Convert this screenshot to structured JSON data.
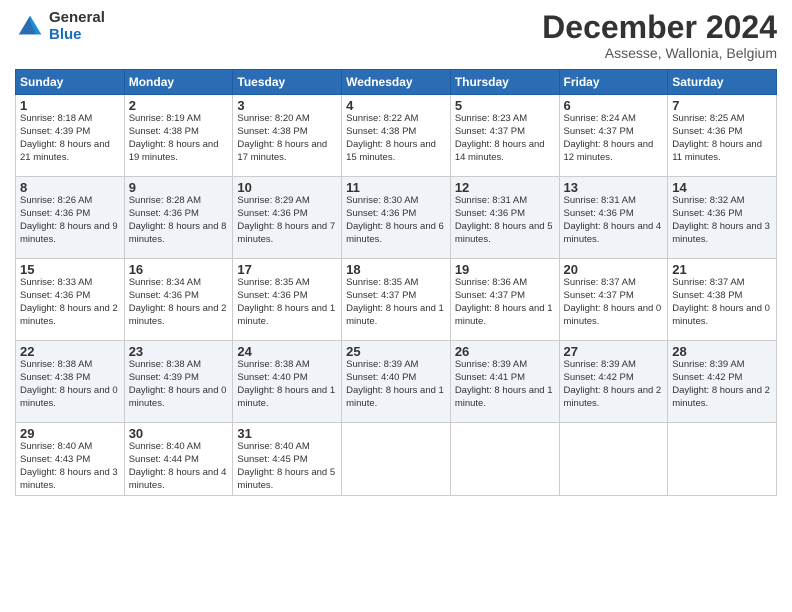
{
  "logo": {
    "general": "General",
    "blue": "Blue"
  },
  "title": {
    "month": "December 2024",
    "location": "Assesse, Wallonia, Belgium"
  },
  "days_header": [
    "Sunday",
    "Monday",
    "Tuesday",
    "Wednesday",
    "Thursday",
    "Friday",
    "Saturday"
  ],
  "weeks": [
    [
      {
        "day": "1",
        "sunrise": "8:18 AM",
        "sunset": "4:39 PM",
        "daylight": "8 hours and 21 minutes."
      },
      {
        "day": "2",
        "sunrise": "8:19 AM",
        "sunset": "4:38 PM",
        "daylight": "8 hours and 19 minutes."
      },
      {
        "day": "3",
        "sunrise": "8:20 AM",
        "sunset": "4:38 PM",
        "daylight": "8 hours and 17 minutes."
      },
      {
        "day": "4",
        "sunrise": "8:22 AM",
        "sunset": "4:38 PM",
        "daylight": "8 hours and 15 minutes."
      },
      {
        "day": "5",
        "sunrise": "8:23 AM",
        "sunset": "4:37 PM",
        "daylight": "8 hours and 14 minutes."
      },
      {
        "day": "6",
        "sunrise": "8:24 AM",
        "sunset": "4:37 PM",
        "daylight": "8 hours and 12 minutes."
      },
      {
        "day": "7",
        "sunrise": "8:25 AM",
        "sunset": "4:36 PM",
        "daylight": "8 hours and 11 minutes."
      }
    ],
    [
      {
        "day": "8",
        "sunrise": "8:26 AM",
        "sunset": "4:36 PM",
        "daylight": "8 hours and 9 minutes."
      },
      {
        "day": "9",
        "sunrise": "8:28 AM",
        "sunset": "4:36 PM",
        "daylight": "8 hours and 8 minutes."
      },
      {
        "day": "10",
        "sunrise": "8:29 AM",
        "sunset": "4:36 PM",
        "daylight": "8 hours and 7 minutes."
      },
      {
        "day": "11",
        "sunrise": "8:30 AM",
        "sunset": "4:36 PM",
        "daylight": "8 hours and 6 minutes."
      },
      {
        "day": "12",
        "sunrise": "8:31 AM",
        "sunset": "4:36 PM",
        "daylight": "8 hours and 5 minutes."
      },
      {
        "day": "13",
        "sunrise": "8:31 AM",
        "sunset": "4:36 PM",
        "daylight": "8 hours and 4 minutes."
      },
      {
        "day": "14",
        "sunrise": "8:32 AM",
        "sunset": "4:36 PM",
        "daylight": "8 hours and 3 minutes."
      }
    ],
    [
      {
        "day": "15",
        "sunrise": "8:33 AM",
        "sunset": "4:36 PM",
        "daylight": "8 hours and 2 minutes."
      },
      {
        "day": "16",
        "sunrise": "8:34 AM",
        "sunset": "4:36 PM",
        "daylight": "8 hours and 2 minutes."
      },
      {
        "day": "17",
        "sunrise": "8:35 AM",
        "sunset": "4:36 PM",
        "daylight": "8 hours and 1 minute."
      },
      {
        "day": "18",
        "sunrise": "8:35 AM",
        "sunset": "4:37 PM",
        "daylight": "8 hours and 1 minute."
      },
      {
        "day": "19",
        "sunrise": "8:36 AM",
        "sunset": "4:37 PM",
        "daylight": "8 hours and 1 minute."
      },
      {
        "day": "20",
        "sunrise": "8:37 AM",
        "sunset": "4:37 PM",
        "daylight": "8 hours and 0 minutes."
      },
      {
        "day": "21",
        "sunrise": "8:37 AM",
        "sunset": "4:38 PM",
        "daylight": "8 hours and 0 minutes."
      }
    ],
    [
      {
        "day": "22",
        "sunrise": "8:38 AM",
        "sunset": "4:38 PM",
        "daylight": "8 hours and 0 minutes."
      },
      {
        "day": "23",
        "sunrise": "8:38 AM",
        "sunset": "4:39 PM",
        "daylight": "8 hours and 0 minutes."
      },
      {
        "day": "24",
        "sunrise": "8:38 AM",
        "sunset": "4:40 PM",
        "daylight": "8 hours and 1 minute."
      },
      {
        "day": "25",
        "sunrise": "8:39 AM",
        "sunset": "4:40 PM",
        "daylight": "8 hours and 1 minute."
      },
      {
        "day": "26",
        "sunrise": "8:39 AM",
        "sunset": "4:41 PM",
        "daylight": "8 hours and 1 minute."
      },
      {
        "day": "27",
        "sunrise": "8:39 AM",
        "sunset": "4:42 PM",
        "daylight": "8 hours and 2 minutes."
      },
      {
        "day": "28",
        "sunrise": "8:39 AM",
        "sunset": "4:42 PM",
        "daylight": "8 hours and 2 minutes."
      }
    ],
    [
      {
        "day": "29",
        "sunrise": "8:40 AM",
        "sunset": "4:43 PM",
        "daylight": "8 hours and 3 minutes."
      },
      {
        "day": "30",
        "sunrise": "8:40 AM",
        "sunset": "4:44 PM",
        "daylight": "8 hours and 4 minutes."
      },
      {
        "day": "31",
        "sunrise": "8:40 AM",
        "sunset": "4:45 PM",
        "daylight": "8 hours and 5 minutes."
      },
      null,
      null,
      null,
      null
    ]
  ]
}
